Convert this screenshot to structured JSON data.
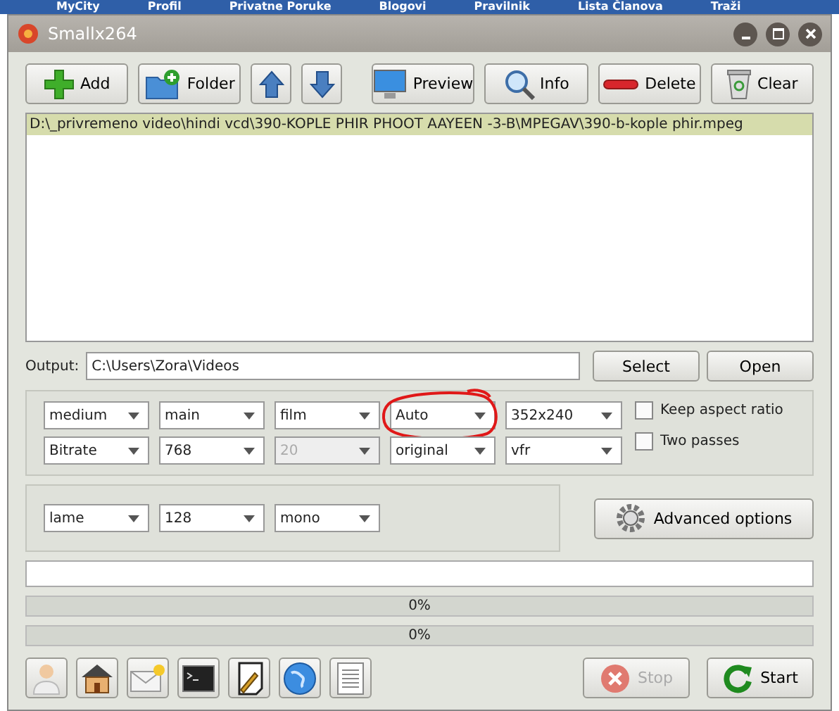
{
  "background_menu": [
    "MyCity",
    "Profil",
    "Privatne Poruke",
    "Blogovi",
    "Pravilnik",
    "Lista Članova",
    "Traži"
  ],
  "window": {
    "title": "Smallx264"
  },
  "toolbar": [
    {
      "kind": "add",
      "label": "Add"
    },
    {
      "kind": "folder",
      "label": "Folder"
    },
    {
      "kind": "up"
    },
    {
      "kind": "down"
    },
    {
      "kind": "preview",
      "label": "Preview"
    },
    {
      "kind": "info",
      "label": "Info"
    },
    {
      "kind": "delete",
      "label": "Delete"
    },
    {
      "kind": "clear",
      "label": "Clear"
    }
  ],
  "file_list": [
    {
      "path": "D:\\_privremeno video\\hindi vcd\\390-KOPLE PHIR PHOOT AAYEEN -3-B\\MPEGAV\\390-b-kople phir.mpeg",
      "selected": true
    }
  ],
  "output": {
    "label": "Output:",
    "value": "C:\\Users\\Zora\\Videos"
  },
  "output_buttons": [
    "Select",
    "Open"
  ],
  "video_options": [
    [
      {
        "value": "medium",
        "disabled": false,
        "circled": false
      },
      {
        "value": "main",
        "disabled": false,
        "circled": false
      },
      {
        "value": "film",
        "disabled": false,
        "circled": false
      },
      {
        "value": "Auto",
        "disabled": false,
        "circled": true
      },
      {
        "value": "352x240",
        "disabled": false,
        "circled": false
      }
    ],
    [
      {
        "value": "Bitrate",
        "disabled": false,
        "circled": false
      },
      {
        "value": "768",
        "disabled": false,
        "circled": false
      },
      {
        "value": "20",
        "disabled": true,
        "circled": false
      },
      {
        "value": "original",
        "disabled": false,
        "circled": false
      },
      {
        "value": "vfr",
        "disabled": false,
        "circled": false
      }
    ]
  ],
  "checkboxes": [
    {
      "label": "Keep aspect ratio",
      "checked": false
    },
    {
      "label": "Two passes",
      "checked": false
    }
  ],
  "audio_options": [
    {
      "value": "lame",
      "disabled": false
    },
    {
      "value": "128",
      "disabled": false
    },
    {
      "value": "mono",
      "disabled": false
    }
  ],
  "advanced_button": "Advanced options",
  "progress": [
    {
      "text": "0%",
      "level": 0
    },
    {
      "text": "0%",
      "level": 0
    }
  ],
  "bottom_icons": [
    {
      "kind": "user"
    },
    {
      "kind": "home"
    },
    {
      "kind": "mail"
    },
    {
      "kind": "terminal"
    },
    {
      "kind": "note"
    },
    {
      "kind": "globe"
    },
    {
      "kind": "document"
    }
  ],
  "actions": [
    {
      "kind": "stop",
      "label": "Stop",
      "disabled": true
    },
    {
      "kind": "start",
      "label": "Start",
      "disabled": false
    }
  ]
}
